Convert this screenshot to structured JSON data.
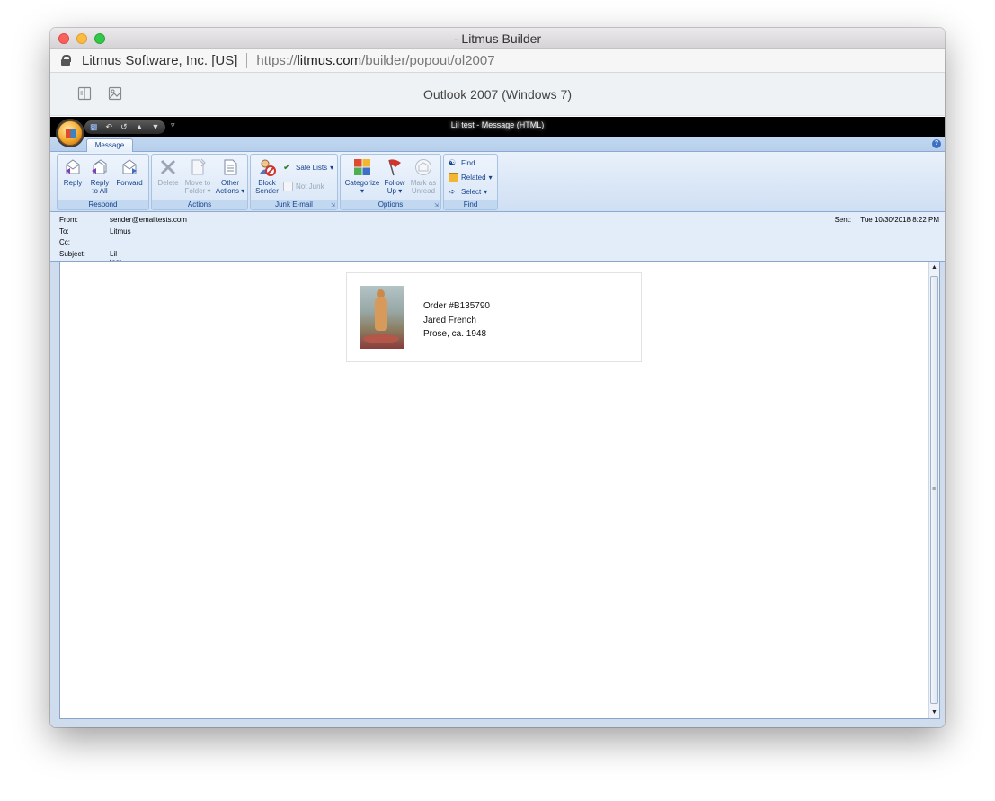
{
  "window": {
    "title": "- Litmus Builder"
  },
  "urlbar": {
    "site_identity": "Litmus Software, Inc. [US]",
    "url_scheme": "https://",
    "url_domain": "litmus.com",
    "url_path": "/builder/popout/ol2007"
  },
  "litmus_bar": {
    "client_name": "Outlook 2007 (Windows 7)",
    "icons": [
      "layout-toggle-icon",
      "image-toggle-icon"
    ]
  },
  "outlook": {
    "caption": "Lil test - Message (HTML)",
    "quick_access": [
      "save-icon",
      "undo-icon",
      "redo-icon",
      "up-arrow-icon",
      "down-arrow-icon"
    ],
    "tabs": [
      "Message"
    ],
    "ribbon": {
      "respond": {
        "label": "Respond",
        "reply": "Reply",
        "reply_all_1": "Reply",
        "reply_all_2": "to All",
        "forward": "Forward"
      },
      "actions": {
        "label": "Actions",
        "delete": "Delete",
        "move_1": "Move to",
        "move_2": "Folder",
        "other_1": "Other",
        "other_2": "Actions"
      },
      "junk": {
        "label": "Junk E-mail",
        "block_1": "Block",
        "block_2": "Sender",
        "safe_lists": "Safe Lists",
        "not_junk": "Not Junk"
      },
      "options": {
        "label": "Options",
        "categorize": "Categorize",
        "follow_1": "Follow",
        "follow_2": "Up",
        "mark_1": "Mark as",
        "mark_2": "Unread"
      },
      "find": {
        "label": "Find",
        "find": "Find",
        "related": "Related",
        "select": "Select"
      }
    },
    "header": {
      "from_label": "From:",
      "from_value": "sender@emailtests.com",
      "to_label": "To:",
      "to_value": "Litmus",
      "cc_label": "Cc:",
      "cc_value": "",
      "subject_label": "Subject:",
      "subject_value": "Lil test",
      "sent_label": "Sent:",
      "sent_value": "Tue 10/30/2018 8:22 PM"
    },
    "email": {
      "order": "Order #B135790",
      "artist": "Jared French",
      "artwork": "Prose, ca. 1948"
    }
  }
}
